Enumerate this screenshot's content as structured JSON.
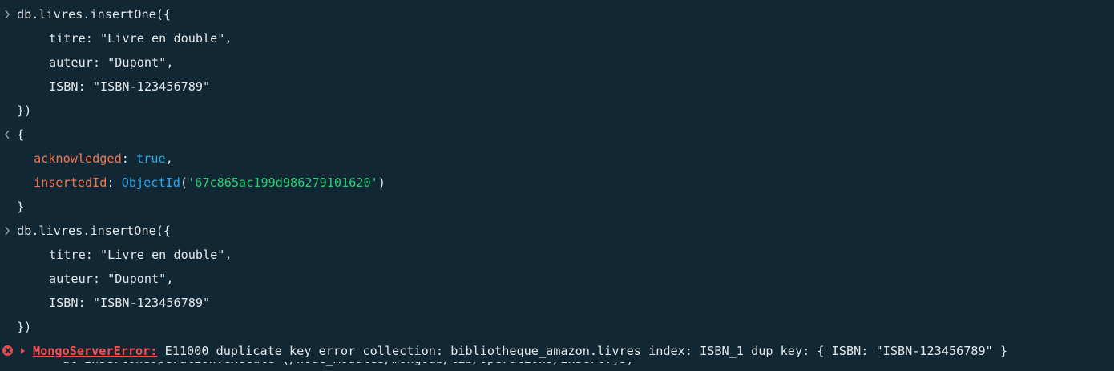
{
  "colors": {
    "background": "#112733",
    "text": "#e3e8ea",
    "key": "#f0764f",
    "keyword": "#2fa6e8",
    "string": "#25d073",
    "error": "#f25052"
  },
  "icons": {
    "input_prompt": "chevron-right-icon",
    "output_marker": "chevron-left-icon",
    "error": "error-circle-icon",
    "expand": "caret-right-icon"
  },
  "entries": {
    "first_input": {
      "open": "db.livres.insertOne({",
      "titre": "titre: \"Livre en double\",",
      "auteur": "auteur: \"Dupont\",",
      "isbn": "ISBN: \"ISBN-123456789\"",
      "close": "})"
    },
    "output": {
      "open": "{",
      "ack_key": "acknowledged",
      "ack_sep": ": ",
      "ack_value": "true",
      "ack_comma": ",",
      "id_key": "insertedId",
      "id_sep": ": ",
      "id_fn": "ObjectId",
      "id_paren_open": "(",
      "id_value": "'67c865ac199d986279101620'",
      "id_paren_close": ")",
      "close": "}"
    },
    "second_input": {
      "open": "db.livres.insertOne({",
      "titre": "titre: \"Livre en double\",",
      "auteur": "auteur: \"Dupont\",",
      "isbn": "ISBN: \"ISBN-123456789\"",
      "close": "})"
    },
    "error": {
      "name": "MongoServerError:",
      "message": " E11000 duplicate key error collection: bibliotheque_amazon.livres index: ISBN_1 dup key: { ISBN: \"ISBN-123456789\" }",
      "next_line_partial": "    at InsertOneOperation.execute (/node_modules/mongodb/lib/operations/insert.js)"
    }
  }
}
